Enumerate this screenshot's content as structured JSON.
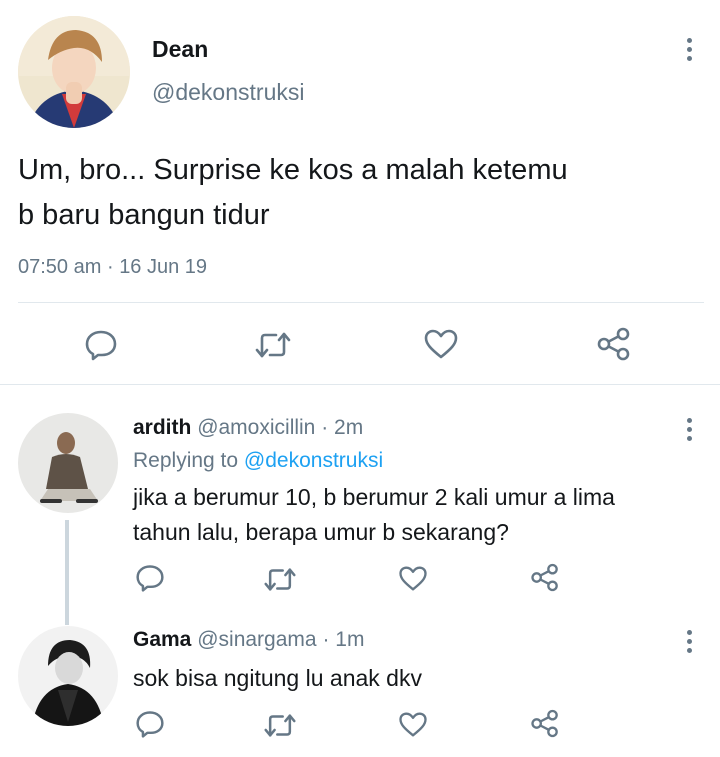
{
  "main_tweet": {
    "name": "Dean",
    "handle": "@dekonstruksi",
    "text_line1": "Um, bro... Surprise ke kos a malah ketemu",
    "text_line2": "b baru bangun tidur",
    "time": "07:50 am",
    "dot": "·",
    "date": "16 Jun 19"
  },
  "replies": [
    {
      "name": "ardith",
      "handle": "@amoxicillin",
      "time": "· 2m",
      "replying_label": "Replying to",
      "replying_handle": "@dekonstruksi",
      "text_line1": "jika a berumur 10, b berumur 2 kali umur a lima",
      "text_line2": "tahun lalu, berapa umur b sekarang?"
    },
    {
      "name": "Gama",
      "handle": "@sinargama",
      "time": "· 1m",
      "text_line1": "sok bisa ngitung lu anak dkv"
    }
  ],
  "colors": {
    "text": "#14171a",
    "secondary": "#657786",
    "link": "#1da1f2",
    "divider": "#e1e8ed"
  },
  "icons": [
    "reply-icon",
    "retweet-icon",
    "like-icon",
    "share-icon",
    "more-icon"
  ]
}
